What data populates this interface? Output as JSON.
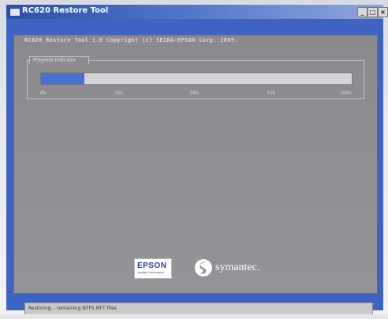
{
  "window": {
    "title": "RC620 Restore Tool",
    "min_glyph": "_",
    "max_glyph": "□",
    "close_glyph": "×",
    "accent_color": "#3f63c2"
  },
  "app": {
    "header": "RC620 Restore Tool 1.0   Copyright (c) SEIKO-EPSON Corp. 2009.",
    "progress": {
      "group_label": "Progress Indicator",
      "value_fraction": 0.14,
      "fill_color": "#4a6fd3",
      "ticks": [
        "0%",
        "25%",
        "50%",
        "75%",
        "100%"
      ]
    },
    "logos": {
      "epson_word": "EPSON",
      "epson_tagline": "EXCEED YOUR VISION",
      "symantec_word": "symantec."
    }
  },
  "status": {
    "text": "Restoring... remaining NTFS MFT files"
  }
}
